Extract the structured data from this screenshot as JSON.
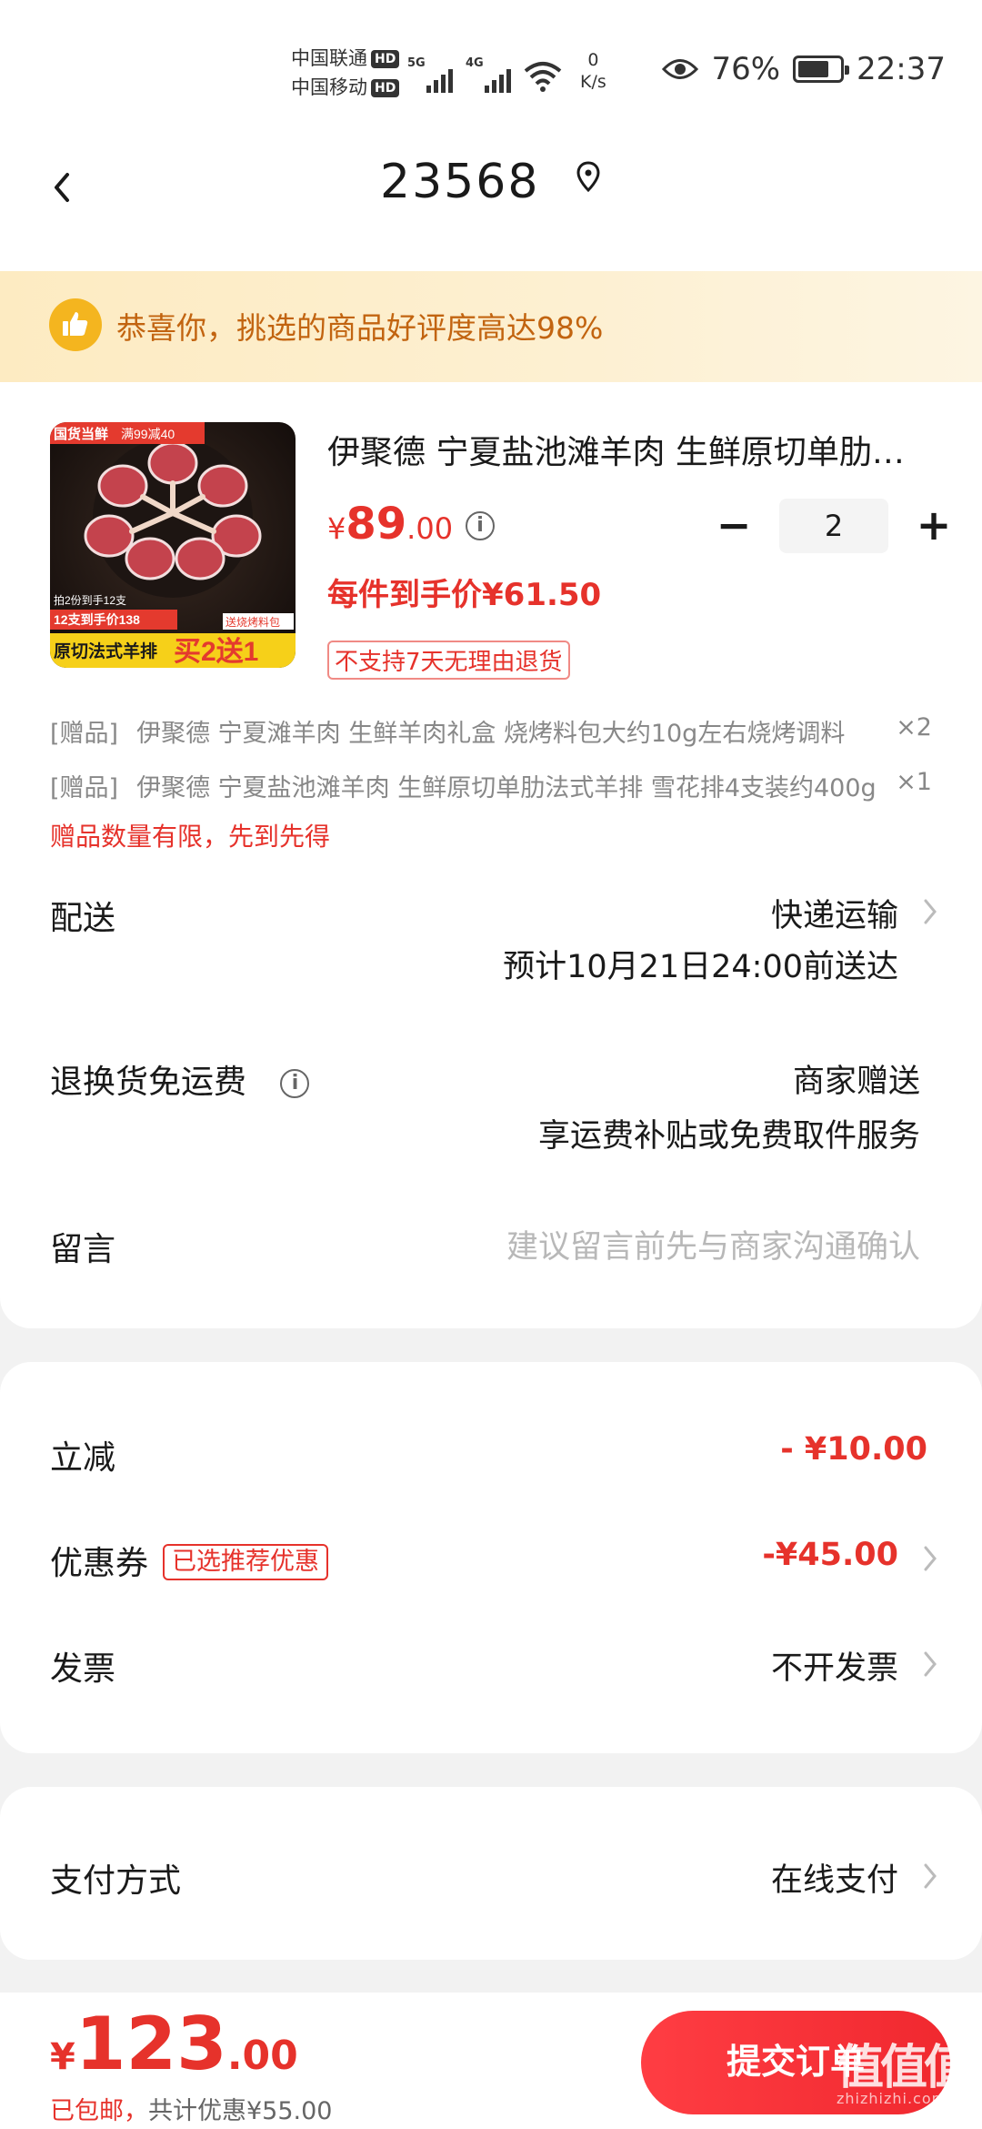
{
  "status": {
    "carrier1": "中国联通",
    "carrier2": "中国移动",
    "hd": "HD",
    "net1": "5G",
    "net2": "4G",
    "speed_val": "0",
    "speed_unit": "K/s",
    "battery": "76%",
    "battery_level": 0.76,
    "time": "22:37"
  },
  "nav": {
    "title": "23568"
  },
  "notice": {
    "text": "恭喜你，挑选的商品好评度高达98%"
  },
  "product": {
    "title": "伊聚德 宁夏盐池滩羊肉 生鲜原切单肋法式羊排",
    "price_cur": "¥",
    "price_int": "89",
    "price_dec": ".00",
    "quantity": "2",
    "unit_price": "每件到手价¥61.50",
    "no_return": "不支持7天无理由退货",
    "image": {
      "badge_top": "国货当鲜",
      "badge_promo": "满99减40",
      "line1": "拍2份到手12支",
      "line2": "12支到手价138",
      "line3": "送烧烤料包",
      "line4": "原切法式羊排",
      "line5": "买2送1"
    }
  },
  "gifts": [
    {
      "tag": "[赠品]",
      "name": "伊聚德 宁夏滩羊肉 生鲜羊肉礼盒 烧烤料包大约10g左右烧烤调料",
      "qty": "×2"
    },
    {
      "tag": "[赠品]",
      "name": "伊聚德 宁夏盐池滩羊肉 生鲜原切单肋法式羊排 雪花排4支装约400g",
      "qty": "×1"
    }
  ],
  "gift_limit": "赠品数量有限，先到先得",
  "delivery": {
    "label": "配送",
    "method": "快递运输",
    "eta": "预计10月21日24:00前送达"
  },
  "return_shipping": {
    "label": "退换货免运费",
    "value": "商家赠送",
    "desc": "享运费补贴或免费取件服务"
  },
  "message": {
    "label": "留言",
    "placeholder": "建议留言前先与商家沟通确认"
  },
  "discount": {
    "label": "立减",
    "value": "- ¥10.00"
  },
  "coupon": {
    "label": "优惠券",
    "tag": "已选推荐优惠",
    "value": "-¥45.00"
  },
  "invoice": {
    "label": "发票",
    "value": "不开发票"
  },
  "payment": {
    "label": "支付方式",
    "value": "在线支付"
  },
  "bottom": {
    "total_cur": "¥",
    "total_int": "123",
    "total_dec": ".00",
    "shipping": "已包邮，",
    "saved": "共计优惠¥55.00",
    "submit": "提交订单"
  },
  "watermark": {
    "text": "值值值",
    "sub": "zhizhizhi.com"
  }
}
